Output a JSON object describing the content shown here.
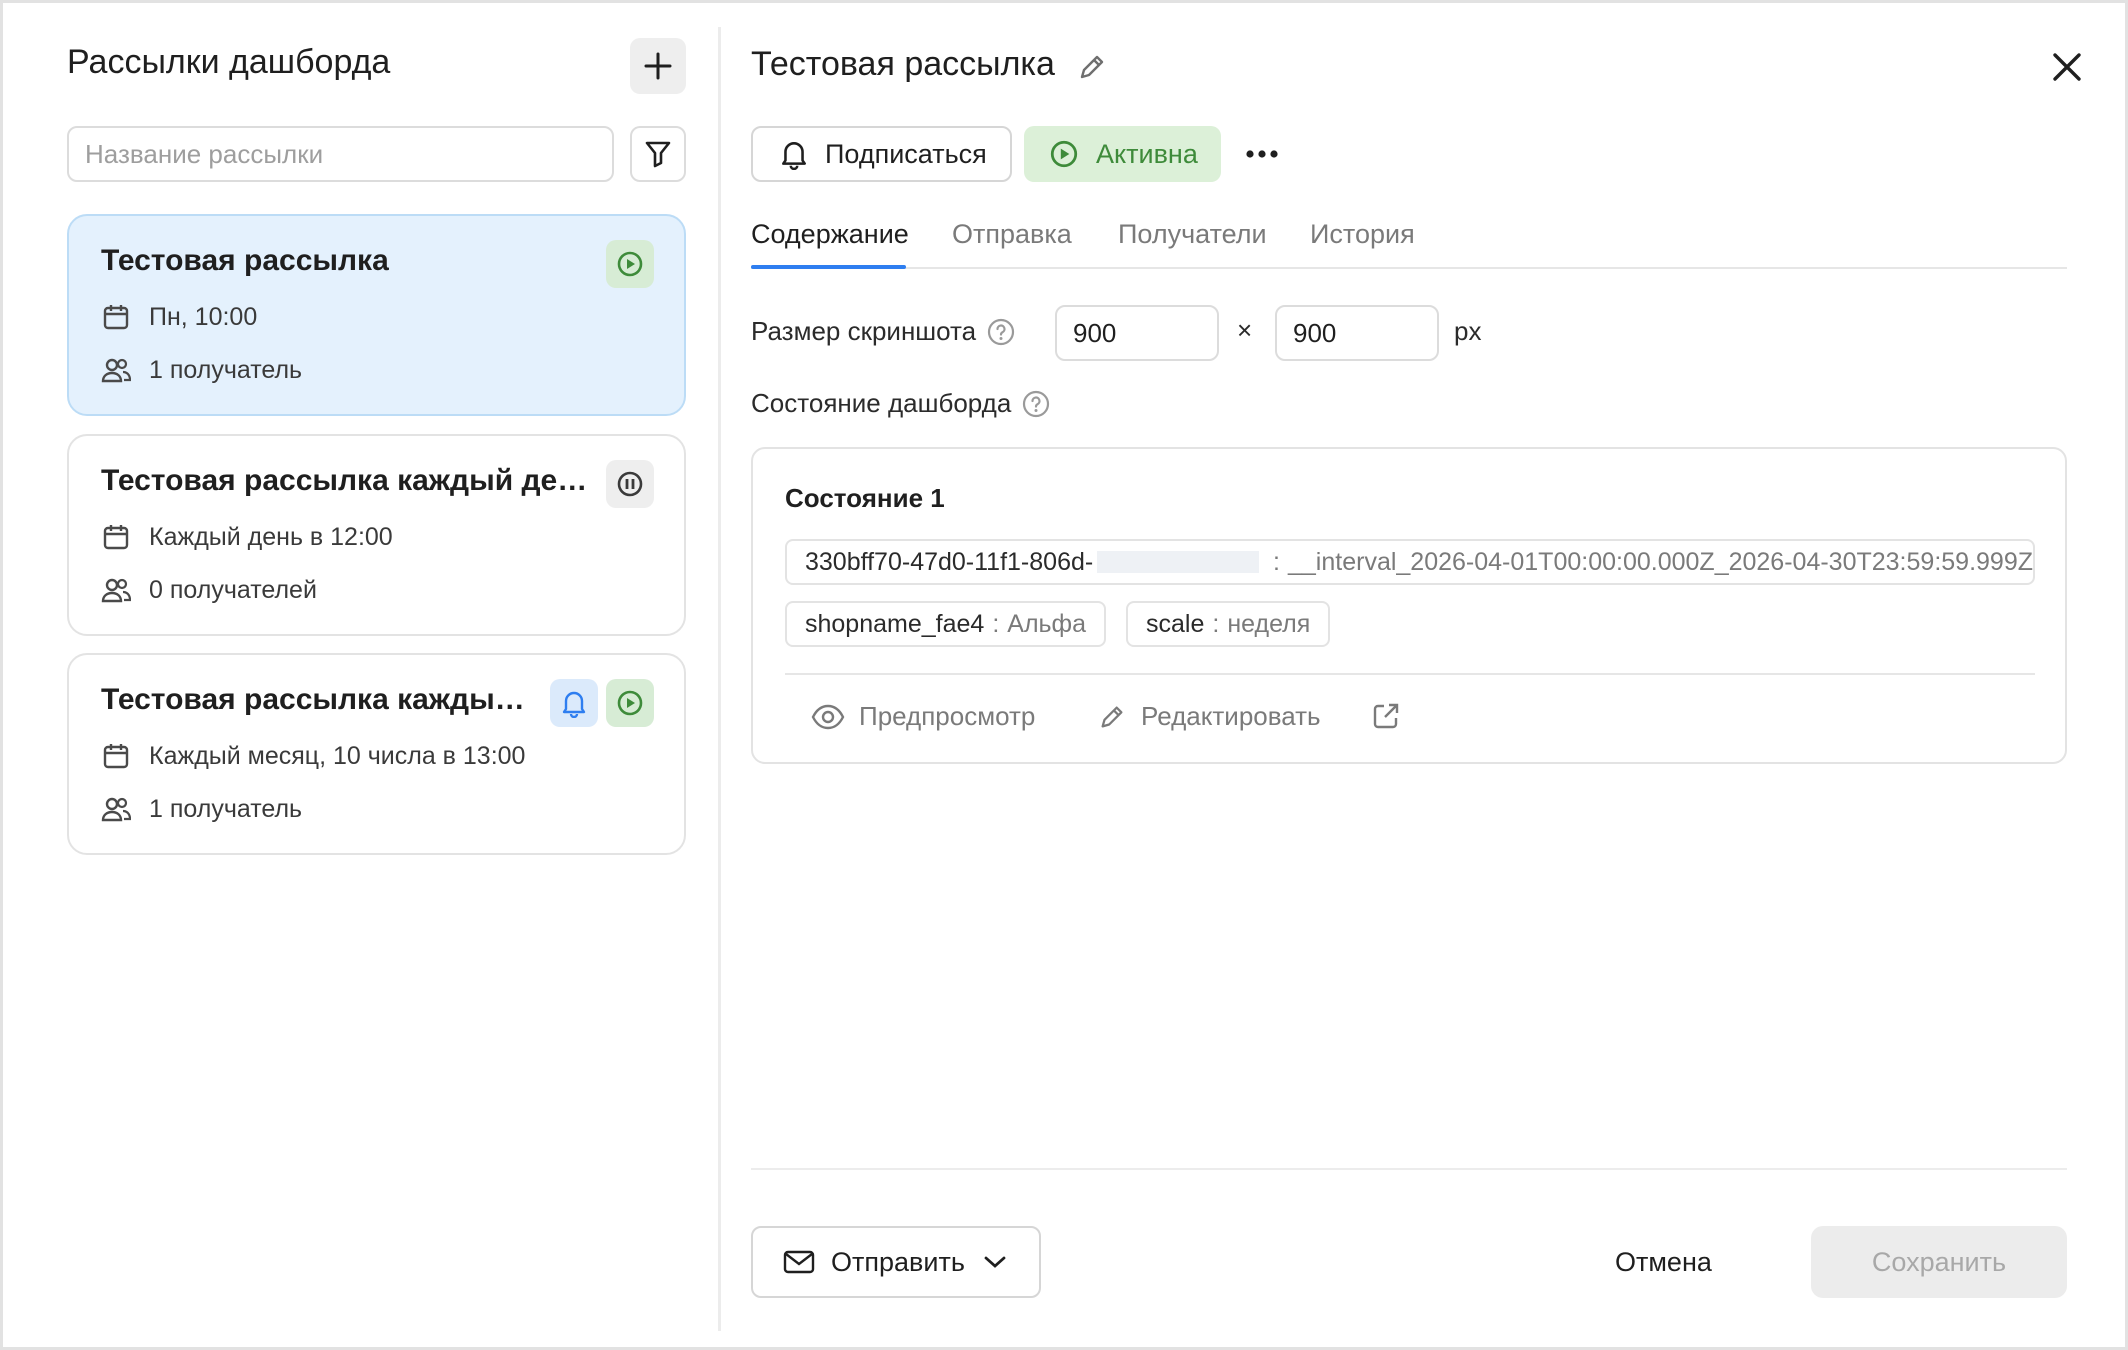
{
  "left_panel": {
    "title": "Рассылки дашборда",
    "search_placeholder": "Название рассылки",
    "mailings": [
      {
        "title": "Тестовая рассылка",
        "schedule": "Пн, 10:00",
        "recipients": "1 получатель",
        "status": "active"
      },
      {
        "title": "Тестовая рассылка каждый день",
        "schedule": "Каждый день в 12:00",
        "recipients": "0 получателей",
        "status": "paused"
      },
      {
        "title": "Тестовая рассылка каждый м...",
        "schedule": "Каждый месяц, 10 числа в 13:00",
        "recipients": "1 получатель",
        "status": "active"
      }
    ]
  },
  "detail": {
    "title": "Тестовая рассылка",
    "subscribe_label": "Подписаться",
    "active_label": "Активна",
    "tabs": [
      "Содержание",
      "Отправка",
      "Получатели",
      "История"
    ],
    "active_tab": "Содержание",
    "screenshot_size_label": "Размер скриншота",
    "width_value": "900",
    "height_value": "900",
    "times_sign": "×",
    "unit": "px",
    "dashboard_state_label": "Состояние дашборда",
    "state": {
      "title": "Состояние 1",
      "param_key": "330bff70-47d0-11f1-806d-",
      "param_sep": ":",
      "param_value": "__interval_2026-04-01T00:00:00.000Z_2026-04-30T23:59:59.999Z",
      "chips": [
        {
          "key": "shopname_fae4",
          "sep": ":",
          "value": "Альфа"
        },
        {
          "key": "scale",
          "sep": ":",
          "value": "неделя"
        }
      ],
      "preview_label": "Предпросмотр",
      "edit_label": "Редактировать"
    },
    "send_label": "Отправить",
    "cancel_label": "Отмена",
    "save_label": "Сохранить"
  },
  "colors": {
    "accent": "#2e7ef0",
    "active_green": "#3e8b3a",
    "active_bg": "#dcf0d8",
    "selected_card_bg": "#e4f1fd"
  },
  "icons": [
    "plus-icon",
    "filter-icon",
    "calendar-icon",
    "people-icon",
    "play-icon",
    "pause-icon",
    "bell-icon",
    "pencil-icon",
    "close-icon",
    "more-icon",
    "help-icon",
    "eye-icon",
    "external-link-icon",
    "mail-icon",
    "chevron-down-icon"
  ]
}
